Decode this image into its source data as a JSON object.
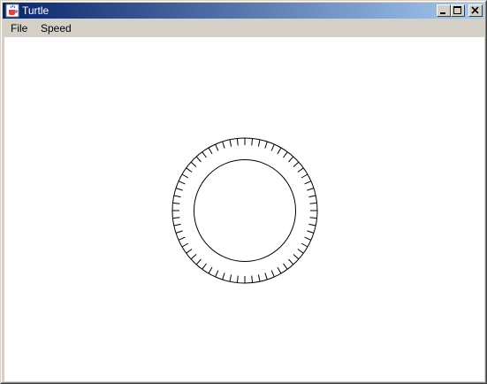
{
  "window": {
    "title": "Turtle",
    "icon": "java-cup-icon"
  },
  "title_buttons": [
    {
      "name": "minimize-button",
      "icon": "minimize-icon"
    },
    {
      "name": "maximize-button",
      "icon": "maximize-icon"
    },
    {
      "name": "close-button",
      "icon": "close-icon"
    }
  ],
  "menu": {
    "items": [
      {
        "label": "File"
      },
      {
        "label": "Speed"
      }
    ]
  },
  "drawing": {
    "description_color": "#000000",
    "tick_count": 60
  }
}
